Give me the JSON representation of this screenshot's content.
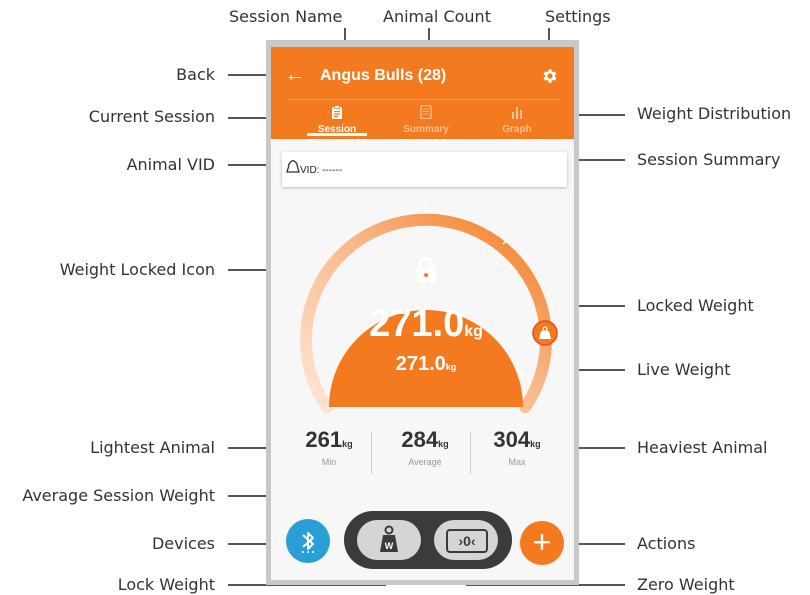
{
  "annotations": {
    "session_name": "Session Name",
    "animal_count": "Animal Count",
    "settings": "Settings",
    "back": "Back",
    "current_session": "Current Session",
    "weight_distribution": "Weight Distribution",
    "animal_vid": "Animal VID",
    "session_summary": "Session Summary",
    "weight_locked_icon": "Weight Locked Icon",
    "locked_weight": "Locked Weight",
    "live_weight": "Live Weight",
    "lightest_animal": "Lightest Animal",
    "heaviest_animal": "Heaviest Animal",
    "average_session_weight": "Average Session Weight",
    "devices": "Devices",
    "actions": "Actions",
    "lock_weight": "Lock Weight",
    "zero_weight": "Zero Weight"
  },
  "app": {
    "back_glyph": "←",
    "title": "Angus Bulls (28)",
    "tabs": [
      {
        "label": "Session",
        "icon": "clipboard-icon",
        "active": true
      },
      {
        "label": "Summary",
        "icon": "document-icon",
        "active": false
      },
      {
        "label": "Graph",
        "icon": "bar-chart-icon",
        "active": false
      }
    ],
    "vid": "VID: ------",
    "gauge": {
      "locked_value": "271.0",
      "locked_unit": "kg",
      "live_value": "271.0",
      "live_unit": "kg"
    },
    "stats": [
      {
        "value": "261",
        "unit": "kg",
        "label": "Min"
      },
      {
        "value": "284",
        "unit": "kg",
        "label": "Average"
      },
      {
        "value": "304",
        "unit": "kg",
        "label": "Max"
      }
    ],
    "weight_button_letter": "W",
    "zero_button_label": "›0‹",
    "plus_glyph": "+"
  },
  "colors": {
    "accent": "#f47a20",
    "bluetooth": "#2a9fd6",
    "pill": "#3b3b3b"
  }
}
